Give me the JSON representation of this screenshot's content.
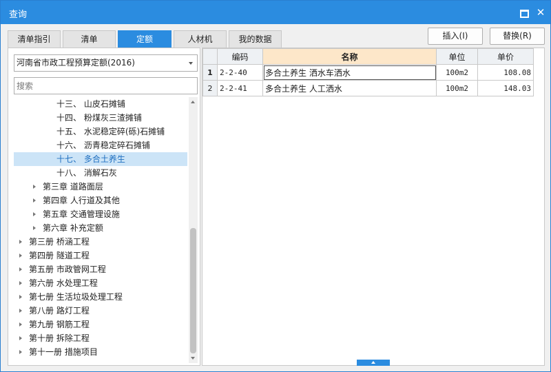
{
  "window": {
    "title": "查询"
  },
  "tabs": [
    {
      "label": "清单指引"
    },
    {
      "label": "清单"
    },
    {
      "label": "定额",
      "active": true
    },
    {
      "label": "人材机"
    },
    {
      "label": "我的数据"
    }
  ],
  "actions": {
    "insert_label": "插入(I)",
    "replace_label": "替换(R)"
  },
  "library": {
    "selected": "河南省市政工程预算定额(2016)"
  },
  "search": {
    "placeholder": "搜索",
    "value": ""
  },
  "tree": {
    "items": [
      {
        "label": "十三、 山皮石摊铺",
        "level": 3,
        "expandable": false,
        "selected": false
      },
      {
        "label": "十四、 粉煤灰三渣摊铺",
        "level": 3,
        "expandable": false,
        "selected": false
      },
      {
        "label": "十五、 水泥稳定碎(砾)石摊铺",
        "level": 3,
        "expandable": false,
        "selected": false
      },
      {
        "label": "十六、 沥青稳定碎石摊铺",
        "level": 3,
        "expandable": false,
        "selected": false
      },
      {
        "label": "十七、 多合土养生",
        "level": 3,
        "expandable": false,
        "selected": true
      },
      {
        "label": "十八、 消解石灰",
        "level": 3,
        "expandable": false,
        "selected": false
      },
      {
        "label": "第三章 道路面层",
        "level": 2,
        "expandable": true,
        "selected": false
      },
      {
        "label": "第四章 人行道及其他",
        "level": 2,
        "expandable": true,
        "selected": false
      },
      {
        "label": "第五章 交通管理设施",
        "level": 2,
        "expandable": true,
        "selected": false
      },
      {
        "label": "第六章 补充定额",
        "level": 2,
        "expandable": true,
        "selected": false
      },
      {
        "label": "第三册 桥涵工程",
        "level": 1,
        "expandable": true,
        "selected": false
      },
      {
        "label": "第四册 隧道工程",
        "level": 1,
        "expandable": true,
        "selected": false
      },
      {
        "label": "第五册 市政管网工程",
        "level": 1,
        "expandable": true,
        "selected": false
      },
      {
        "label": "第六册 水处理工程",
        "level": 1,
        "expandable": true,
        "selected": false
      },
      {
        "label": "第七册 生活垃圾处理工程",
        "level": 1,
        "expandable": true,
        "selected": false
      },
      {
        "label": "第八册 路灯工程",
        "level": 1,
        "expandable": true,
        "selected": false
      },
      {
        "label": "第九册 钢筋工程",
        "level": 1,
        "expandable": true,
        "selected": false
      },
      {
        "label": "第十册 拆除工程",
        "level": 1,
        "expandable": true,
        "selected": false
      },
      {
        "label": "第十一册 措施项目",
        "level": 1,
        "expandable": true,
        "selected": false
      }
    ]
  },
  "table": {
    "columns": {
      "code": "编码",
      "name": "名称",
      "unit": "单位",
      "price": "单价"
    },
    "rows": [
      {
        "index": "1",
        "code": "2-2-40",
        "name": "多合土养生  洒水车洒水",
        "unit": "100m2",
        "price": "108.08"
      },
      {
        "index": "2",
        "code": "2-2-41",
        "name": "多合土养生  人工洒水",
        "unit": "100m2",
        "price": "148.03"
      }
    ]
  },
  "icons": [
    "maximize-icon",
    "close-icon",
    "dropdown-arrow-icon",
    "tree-expand-icon",
    "scroll-up-icon",
    "scroll-down-icon",
    "collapse-up-icon"
  ],
  "colors": {
    "accent": "#2b8ce0",
    "selected_row": "#cce4f7",
    "header_highlight": "#fde7c9"
  }
}
